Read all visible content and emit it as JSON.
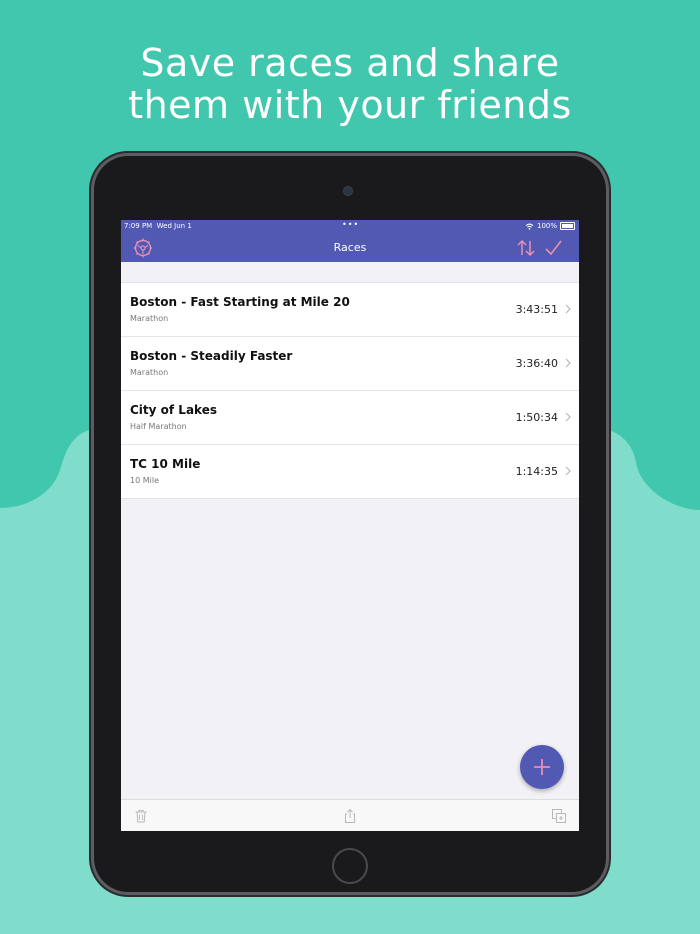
{
  "headline": {
    "line1": "Save races and share",
    "line2": "them with your friends"
  },
  "colors": {
    "background_top": "#41c7ad",
    "background_bottom": "#80dccb",
    "nav_bar": "#5159b3",
    "accent_pink": "#e98fb3",
    "fab": "#5159b3"
  },
  "status_bar": {
    "time": "7:09 PM",
    "date": "Wed Jun 1",
    "dots": "•••",
    "battery": "100%"
  },
  "nav": {
    "title": "Races",
    "left_icon": "settings-gear-icon",
    "right_icons": [
      "sort-arrows-icon",
      "checkmark-icon"
    ]
  },
  "races": [
    {
      "name": "Boston - Fast Starting at Mile 20",
      "type": "Marathon",
      "time": "3:43:51"
    },
    {
      "name": "Boston - Steadily Faster",
      "type": "Marathon",
      "time": "3:36:40"
    },
    {
      "name": "City of Lakes",
      "type": "Half Marathon",
      "time": "1:50:34"
    },
    {
      "name": "TC 10 Mile",
      "type": "10 Mile",
      "time": "1:14:35"
    }
  ],
  "toolbar": {
    "icons": [
      "trash-icon",
      "share-icon",
      "duplicate-icon"
    ]
  }
}
